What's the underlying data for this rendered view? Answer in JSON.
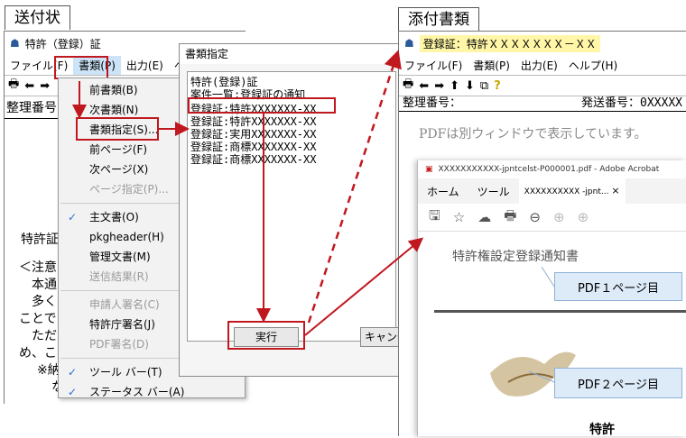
{
  "left_label": "送付状",
  "right_label": "添付書類",
  "left_window": {
    "title": "特許（登録）証",
    "menu": [
      "ファイル(F)",
      "書類(P)",
      "出力(E)",
      "ヘル"
    ],
    "seiri_label": "整理番号",
    "body_lines": [
      "特許証",
      "＜注意",
      "本通",
      "多く",
      "ことで",
      "ただ",
      "め、こ",
      "※納",
      "な"
    ]
  },
  "dropdown": {
    "items": [
      {
        "label": "前書類(B)",
        "disabled": false,
        "checked": false
      },
      {
        "label": "次書類(N)",
        "disabled": false,
        "checked": false
      },
      {
        "label": "書類指定(S)...",
        "disabled": false,
        "checked": false
      },
      {
        "label": "前ページ(F)",
        "disabled": false,
        "checked": false
      },
      {
        "label": "次ページ(X)",
        "disabled": false,
        "checked": false
      },
      {
        "label": "ページ指定(P)...",
        "disabled": true,
        "checked": false
      },
      {
        "sep": true
      },
      {
        "label": "主文書(O)",
        "disabled": false,
        "checked": true
      },
      {
        "label": "pkgheader(H)",
        "disabled": false,
        "checked": false
      },
      {
        "label": "管理文書(M)",
        "disabled": false,
        "checked": false
      },
      {
        "label": "送信結果(R)",
        "disabled": true,
        "checked": false
      },
      {
        "sep": true
      },
      {
        "label": "申請人署名(C)",
        "disabled": true,
        "checked": false
      },
      {
        "label": "特許庁署名(J)",
        "disabled": false,
        "checked": false
      },
      {
        "label": "PDF署名(D)",
        "disabled": true,
        "checked": false
      },
      {
        "sep": true
      },
      {
        "label": "ツール バー(T)",
        "disabled": false,
        "checked": true
      },
      {
        "label": "ステータス バー(A)",
        "disabled": false,
        "checked": true
      }
    ]
  },
  "dialog": {
    "title": "書類指定",
    "list": [
      "特許(登録)証",
      "案件一覧:登録証の通知",
      "登録証:特許XXXXXXX-XX",
      "登録証:特許XXXXXXX-XX",
      "登録証:実用XXXXXXX-XX",
      "登録証:商標XXXXXXX-XX",
      "登録証:商標XXXXXXX-XX"
    ],
    "execute": "実行",
    "cancel": "キャンセル"
  },
  "right_window": {
    "title": "登録証：特許ＸＸＸＸＸＸＸ－ＸＸ",
    "menu": [
      "ファイル(F)",
      "書類(P)",
      "出力(E)",
      "ヘルプ(H)"
    ],
    "seiri_label": "整理番号：",
    "hasso_label": "発送番号：0XXXXX",
    "pdf_note": "PDFは別ウィンドウで表示しています。"
  },
  "pdf_viewer": {
    "tab_title": "XXXXXXXXXXX-jpntcelst-P000001.pdf - Adobe Acrobat",
    "tabs": [
      "ホーム",
      "ツール",
      "XXXXXXXXXX -jpnt..."
    ],
    "close": "×",
    "page1_heading": "特許権設定登録通知書",
    "page2_text": "特許"
  },
  "callouts": [
    "PDF１ページ目",
    "PDF２ページ目"
  ]
}
